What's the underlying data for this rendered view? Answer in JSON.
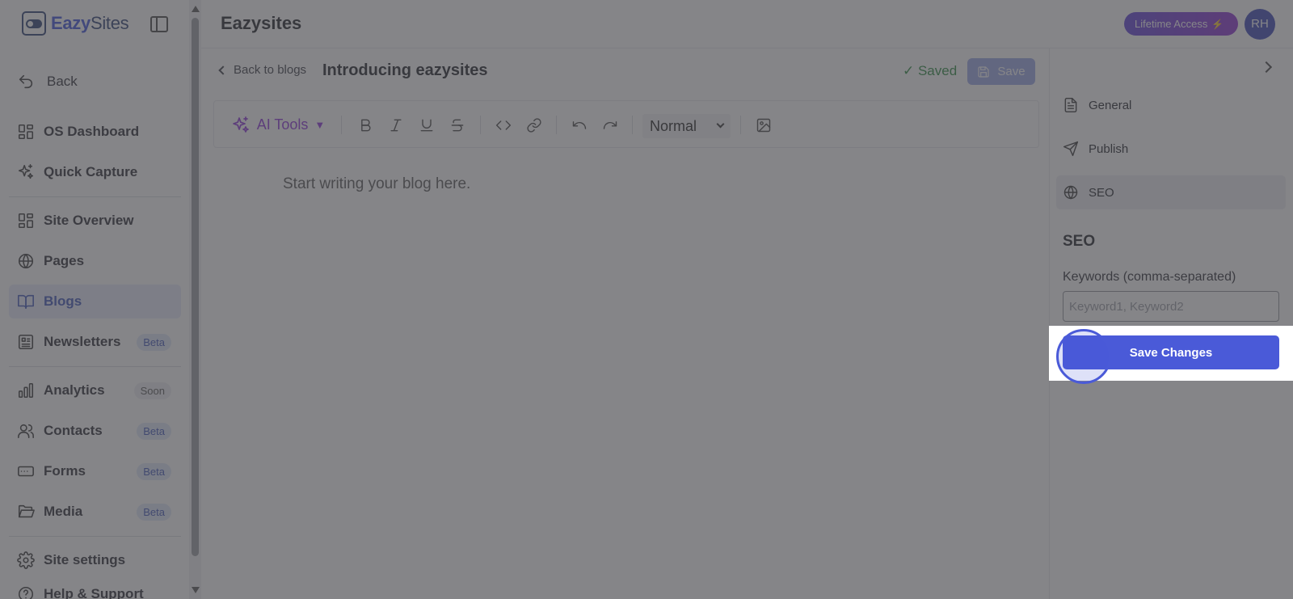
{
  "sidebar": {
    "brand": {
      "prefix": "Eazy",
      "suffix": "Sites"
    },
    "back_label": "Back",
    "items": [
      {
        "label": "OS Dashboard",
        "icon": "dashboard-icon"
      },
      {
        "label": "Quick Capture",
        "icon": "sparkles-icon"
      },
      {
        "label": "Site Overview",
        "icon": "dashboard-icon"
      },
      {
        "label": "Pages",
        "icon": "globe-icon"
      },
      {
        "label": "Blogs",
        "icon": "book-icon",
        "active": true
      },
      {
        "label": "Newsletters",
        "icon": "newspaper-icon",
        "badge": "Beta"
      },
      {
        "label": "Analytics",
        "icon": "bar-chart-icon",
        "badge": "Soon"
      },
      {
        "label": "Contacts",
        "icon": "users-icon",
        "badge": "Beta"
      },
      {
        "label": "Forms",
        "icon": "form-icon",
        "badge": "Beta"
      },
      {
        "label": "Media",
        "icon": "folder-icon",
        "badge": "Beta"
      },
      {
        "label": "Site settings",
        "icon": "gear-icon"
      },
      {
        "label": "Help & Support",
        "icon": "help-icon"
      }
    ]
  },
  "header": {
    "title": "Eazysites",
    "lifetime_label": "Lifetime Access",
    "avatar_initials": "RH"
  },
  "editor": {
    "back_label": "Back to blogs",
    "post_title": "Introducing eazysites",
    "saved_status": "✓ Saved",
    "save_label": "Save",
    "toolbar": {
      "ai_tools_label": "AI Tools",
      "style_value": "Normal"
    },
    "placeholder": "Start writing your blog here."
  },
  "panel": {
    "tabs": [
      {
        "label": "General",
        "icon": "document-icon"
      },
      {
        "label": "Publish",
        "icon": "send-icon"
      },
      {
        "label": "SEO",
        "icon": "globe-icon",
        "active": true
      }
    ],
    "seo_heading": "SEO",
    "keywords_label": "Keywords (comma-separated)",
    "keywords_placeholder": "Keyword1, Keyword2",
    "keywords_value": "",
    "save_changes_label": "Save Changes"
  },
  "colors": {
    "accent": "#4a5ad8",
    "brand": "#2b3e74",
    "ai_purple": "#8a30d8",
    "saved_green": "#2a8a3f",
    "overlay": "rgba(70,70,74,0.66)"
  }
}
